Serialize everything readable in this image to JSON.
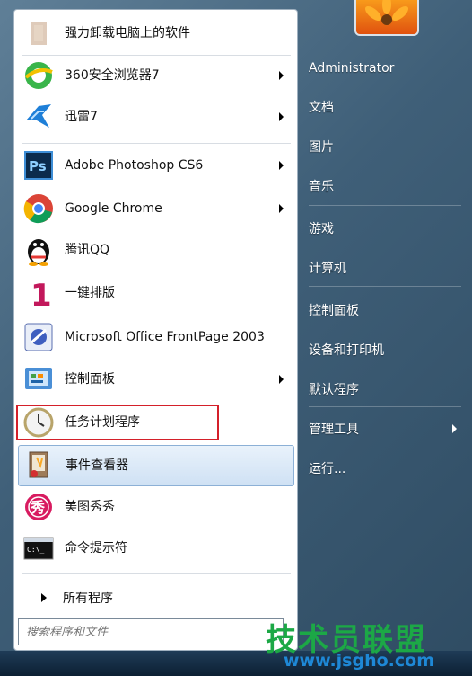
{
  "left_items": [
    {
      "label": "强力卸载电脑上的软件",
      "icon": "uninstaller-icon",
      "has_arrow": false
    },
    {
      "label": "360安全浏览器7",
      "icon": "360-browser-icon",
      "has_arrow": true
    },
    {
      "label": "迅雷7",
      "icon": "xunlei-bird-icon",
      "has_arrow": true
    },
    {
      "label": "Adobe Photoshop CS6",
      "icon": "photoshop-icon",
      "has_arrow": true
    },
    {
      "label": "Google Chrome",
      "icon": "chrome-icon",
      "has_arrow": true
    },
    {
      "label": "腾讯QQ",
      "icon": "qq-penguin-icon",
      "has_arrow": false
    },
    {
      "label": "一键排版",
      "icon": "number-one-icon",
      "has_arrow": false
    },
    {
      "label": "Microsoft Office FrontPage 2003",
      "icon": "frontpage-icon",
      "has_arrow": false
    },
    {
      "label": "控制面板",
      "icon": "control-panel-icon",
      "has_arrow": true
    },
    {
      "label": "任务计划程序",
      "icon": "task-scheduler-clock-icon",
      "has_arrow": false
    },
    {
      "label": "事件查看器",
      "icon": "event-viewer-icon",
      "has_arrow": false
    },
    {
      "label": "美图秀秀",
      "icon": "meitu-icon",
      "has_arrow": false
    },
    {
      "label": "命令提示符",
      "icon": "command-prompt-icon",
      "has_arrow": false
    }
  ],
  "all_programs": "所有程序",
  "search_placeholder": "搜索程序和文件",
  "right_items": [
    {
      "label": "Administrator",
      "has_arrow": false
    },
    {
      "label": "文档",
      "has_arrow": false
    },
    {
      "label": "图片",
      "has_arrow": false
    },
    {
      "label": "音乐",
      "has_arrow": false
    },
    {
      "label": "游戏",
      "has_arrow": false
    },
    {
      "label": "计算机",
      "has_arrow": false
    },
    {
      "label": "控制面板",
      "has_arrow": false
    },
    {
      "label": "设备和打印机",
      "has_arrow": false
    },
    {
      "label": "默认程序",
      "has_arrow": false
    },
    {
      "label": "管理工具",
      "has_arrow": true
    },
    {
      "label": "运行...",
      "has_arrow": false
    }
  ],
  "watermark": {
    "title": "技术员联盟",
    "url": "www.jsgho.com"
  },
  "colors": {
    "highlight_border": "#8cb0d6",
    "red_box": "#d4202a",
    "watermark_green": "#1ca846",
    "watermark_blue": "#1e88d6"
  }
}
